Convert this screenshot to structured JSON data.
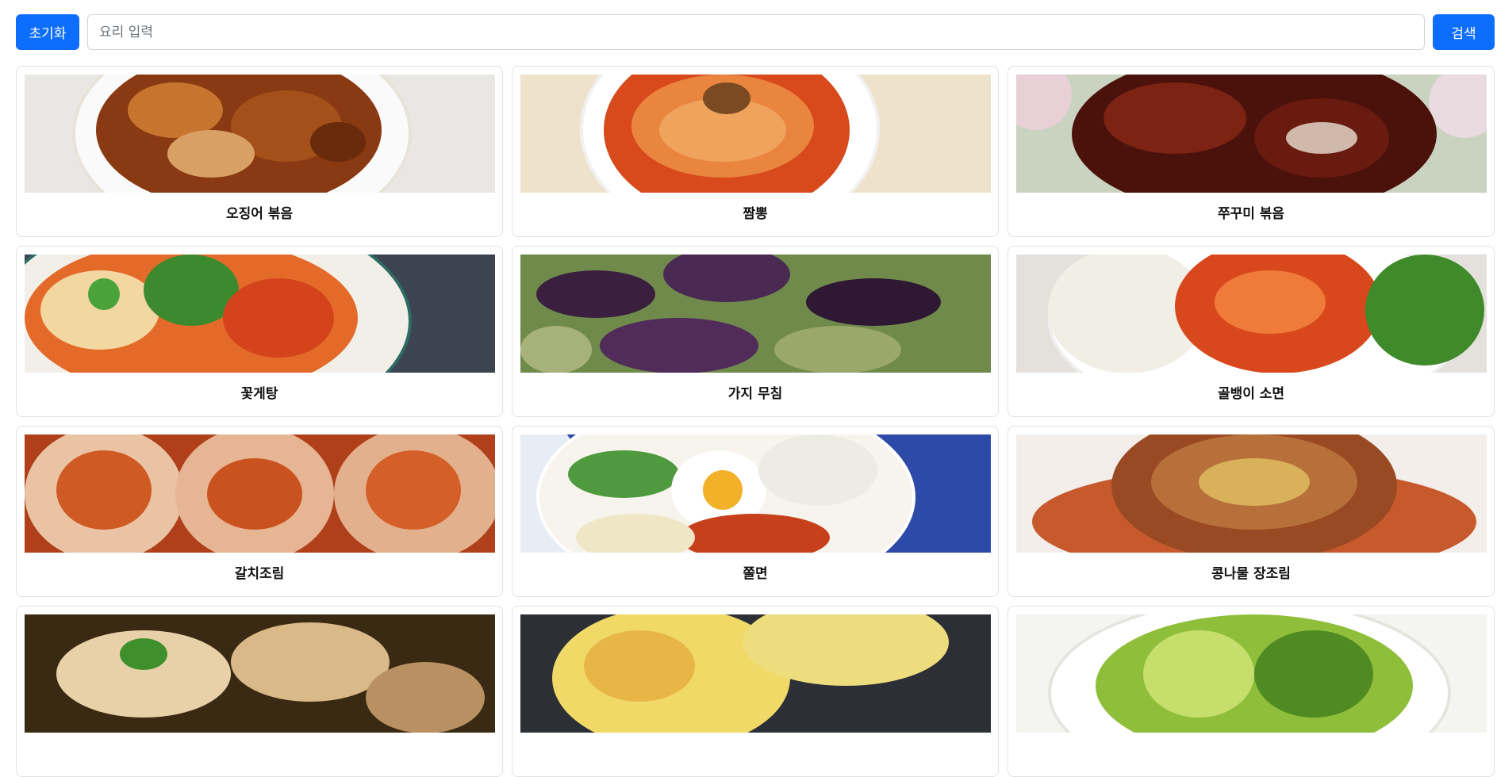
{
  "toolbar": {
    "reset_label": "초기화",
    "search_placeholder": "요리 입력",
    "search_value": "",
    "search_label": "검색",
    "accent_color": "#0d6efd"
  },
  "recipes": [
    {
      "title": "오징어 볶음"
    },
    {
      "title": "짬뽕"
    },
    {
      "title": "쭈꾸미 볶음"
    },
    {
      "title": "꽃게탕"
    },
    {
      "title": "가지 무침"
    },
    {
      "title": "골뱅이 소면"
    },
    {
      "title": "갈치조림"
    },
    {
      "title": "쫄면"
    },
    {
      "title": "콩나물 장조림"
    },
    {
      "title": ""
    },
    {
      "title": ""
    },
    {
      "title": ""
    }
  ]
}
